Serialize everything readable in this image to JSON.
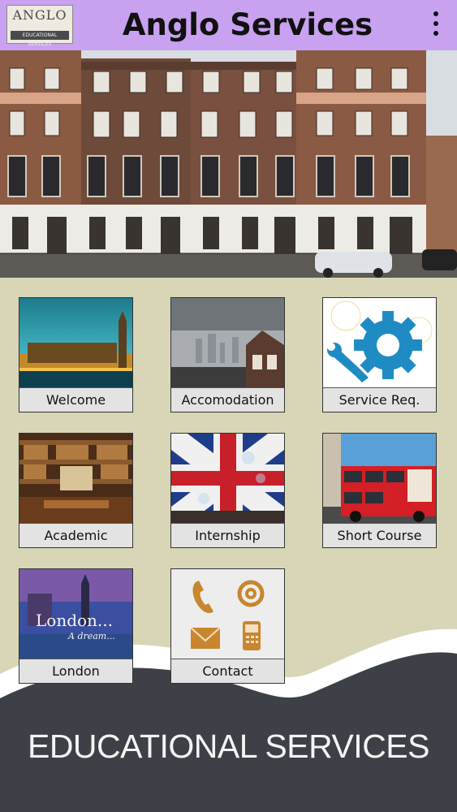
{
  "header": {
    "logo_main": "ANGLO",
    "logo_sub": "EDUCATIONAL SERVICES",
    "title": "Anglo Services",
    "menu_icon": "more-vertical-icon"
  },
  "tiles": [
    {
      "label": "Welcome",
      "image": "london-parliament-sunset"
    },
    {
      "label": "Accomodation",
      "image": "london-skyline-rooftops"
    },
    {
      "label": "Service Req.",
      "image": "gear-wrench-icon"
    },
    {
      "label": "Academic",
      "image": "library-reading-room"
    },
    {
      "label": "Internship",
      "image": "union-jack-flag"
    },
    {
      "label": "Short Course",
      "image": "red-double-decker-bus"
    },
    {
      "label": "London",
      "image": "london-a-dream-poster",
      "overlay_title": "London...",
      "overlay_sub": "A dream..."
    },
    {
      "label": "Contact",
      "image": "contact-icons"
    }
  ],
  "footer": {
    "text": "EDUCATIONAL SERVICES"
  },
  "colors": {
    "header_bg": "#c8a2f0",
    "page_bg": "#d9d5b7",
    "footer_band": "#3d4047",
    "gear_blue": "#1e8bc3"
  }
}
